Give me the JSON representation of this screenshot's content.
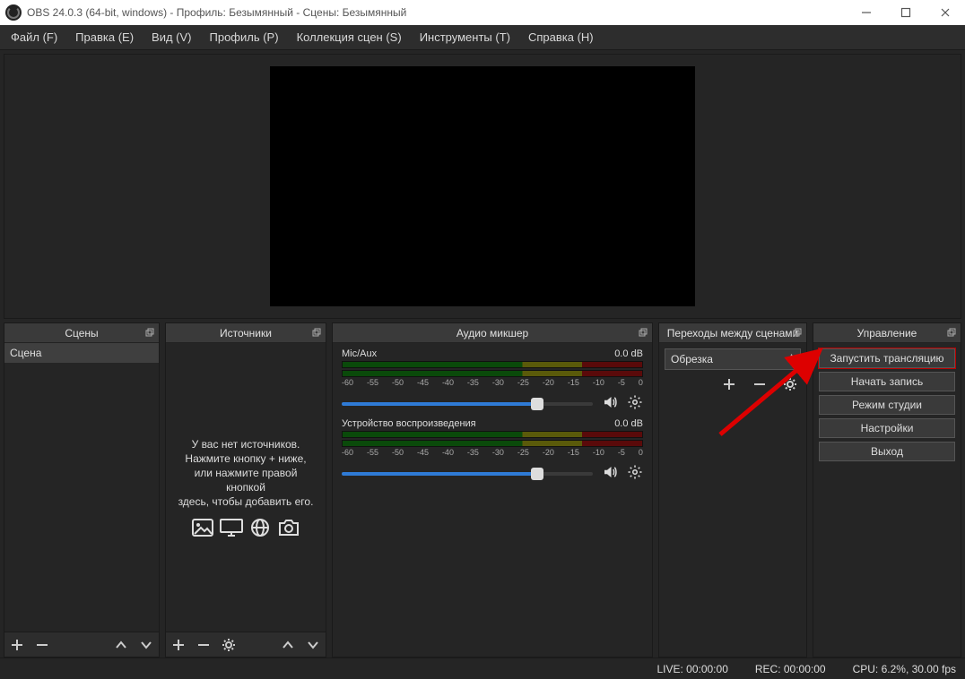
{
  "titlebar": {
    "title": "OBS 24.0.3 (64-bit, windows) - Профиль: Безымянный - Сцены: Безымянный"
  },
  "menu": {
    "file": "Файл (F)",
    "edit": "Правка (E)",
    "view": "Вид (V)",
    "profile": "Профиль (P)",
    "scenes": "Коллекция сцен (S)",
    "tools": "Инструменты (T)",
    "help": "Справка (H)"
  },
  "docks": {
    "scenes": {
      "title": "Сцены"
    },
    "sources": {
      "title": "Источники"
    },
    "mixer": {
      "title": "Аудио микшер"
    },
    "transitions": {
      "title": "Переходы между сценами"
    },
    "controls": {
      "title": "Управление"
    }
  },
  "scenes": {
    "items": [
      {
        "name": "Сцена"
      }
    ]
  },
  "sources": {
    "empty_line1": "У вас нет источников.",
    "empty_line2": "Нажмите кнопку + ниже,",
    "empty_line3": "или нажмите правой кнопкой",
    "empty_line4": "здесь, чтобы добавить его."
  },
  "mixer": {
    "ticks": [
      "-60",
      "-55",
      "-50",
      "-45",
      "-40",
      "-35",
      "-30",
      "-25",
      "-20",
      "-15",
      "-10",
      "-5",
      "0"
    ],
    "channels": [
      {
        "name": "Mic/Aux",
        "level_db": "0.0 dB",
        "slider_pct": 78
      },
      {
        "name": "Устройство воспроизведения",
        "level_db": "0.0 dB",
        "slider_pct": 78
      }
    ]
  },
  "transitions": {
    "selected": "Обрезка"
  },
  "controls": {
    "start_stream": "Запустить трансляцию",
    "start_record": "Начать запись",
    "studio_mode": "Режим студии",
    "settings": "Настройки",
    "exit": "Выход"
  },
  "status": {
    "live": "LIVE: 00:00:00",
    "rec": "REC: 00:00:00",
    "cpu": "CPU: 6.2%, 30.00 fps"
  }
}
